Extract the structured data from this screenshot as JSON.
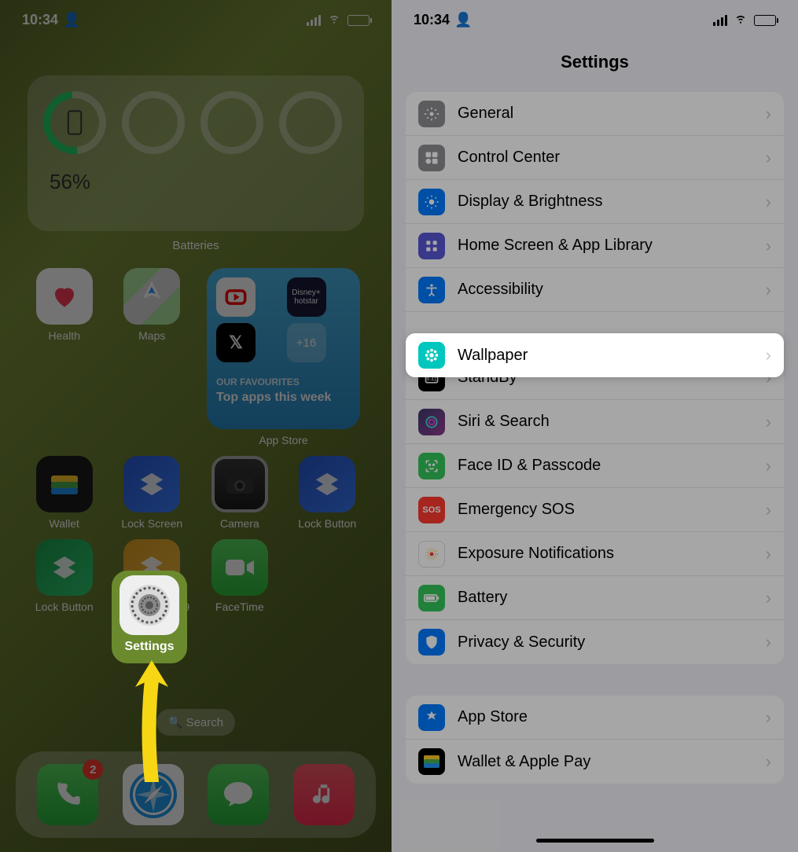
{
  "status": {
    "time": "10:34",
    "battery_pct": "56%"
  },
  "home": {
    "widget": {
      "label": "Batteries",
      "pct": "56%"
    },
    "apps": {
      "health": "Health",
      "maps": "Maps",
      "appstore": "App Store",
      "appstore_sub": "OUR FAVOURITES",
      "appstore_title": "Top apps this week",
      "appstore_more": "+16",
      "hotstar": "Disney+ hotstar",
      "wallet": "Wallet",
      "lockscreen": "Lock Screen",
      "camera": "Camera",
      "lockbutton1": "Lock Button",
      "lockbutton2": "Lock Button",
      "newshortcut": "New Shortcut 9",
      "facetime": "FaceTime",
      "settings": "Settings"
    },
    "search": "Search",
    "dock": {
      "phone_badge": "2"
    }
  },
  "settings": {
    "title": "Settings",
    "rows": {
      "general": "General",
      "control_center": "Control Center",
      "display": "Display & Brightness",
      "home_screen": "Home Screen & App Library",
      "accessibility": "Accessibility",
      "wallpaper": "Wallpaper",
      "standby": "StandBy",
      "siri": "Siri & Search",
      "faceid": "Face ID & Passcode",
      "emergency": "Emergency SOS",
      "exposure": "Exposure Notifications",
      "battery": "Battery",
      "privacy": "Privacy & Security",
      "app_store": "App Store",
      "wallet_pay": "Wallet & Apple Pay"
    }
  }
}
